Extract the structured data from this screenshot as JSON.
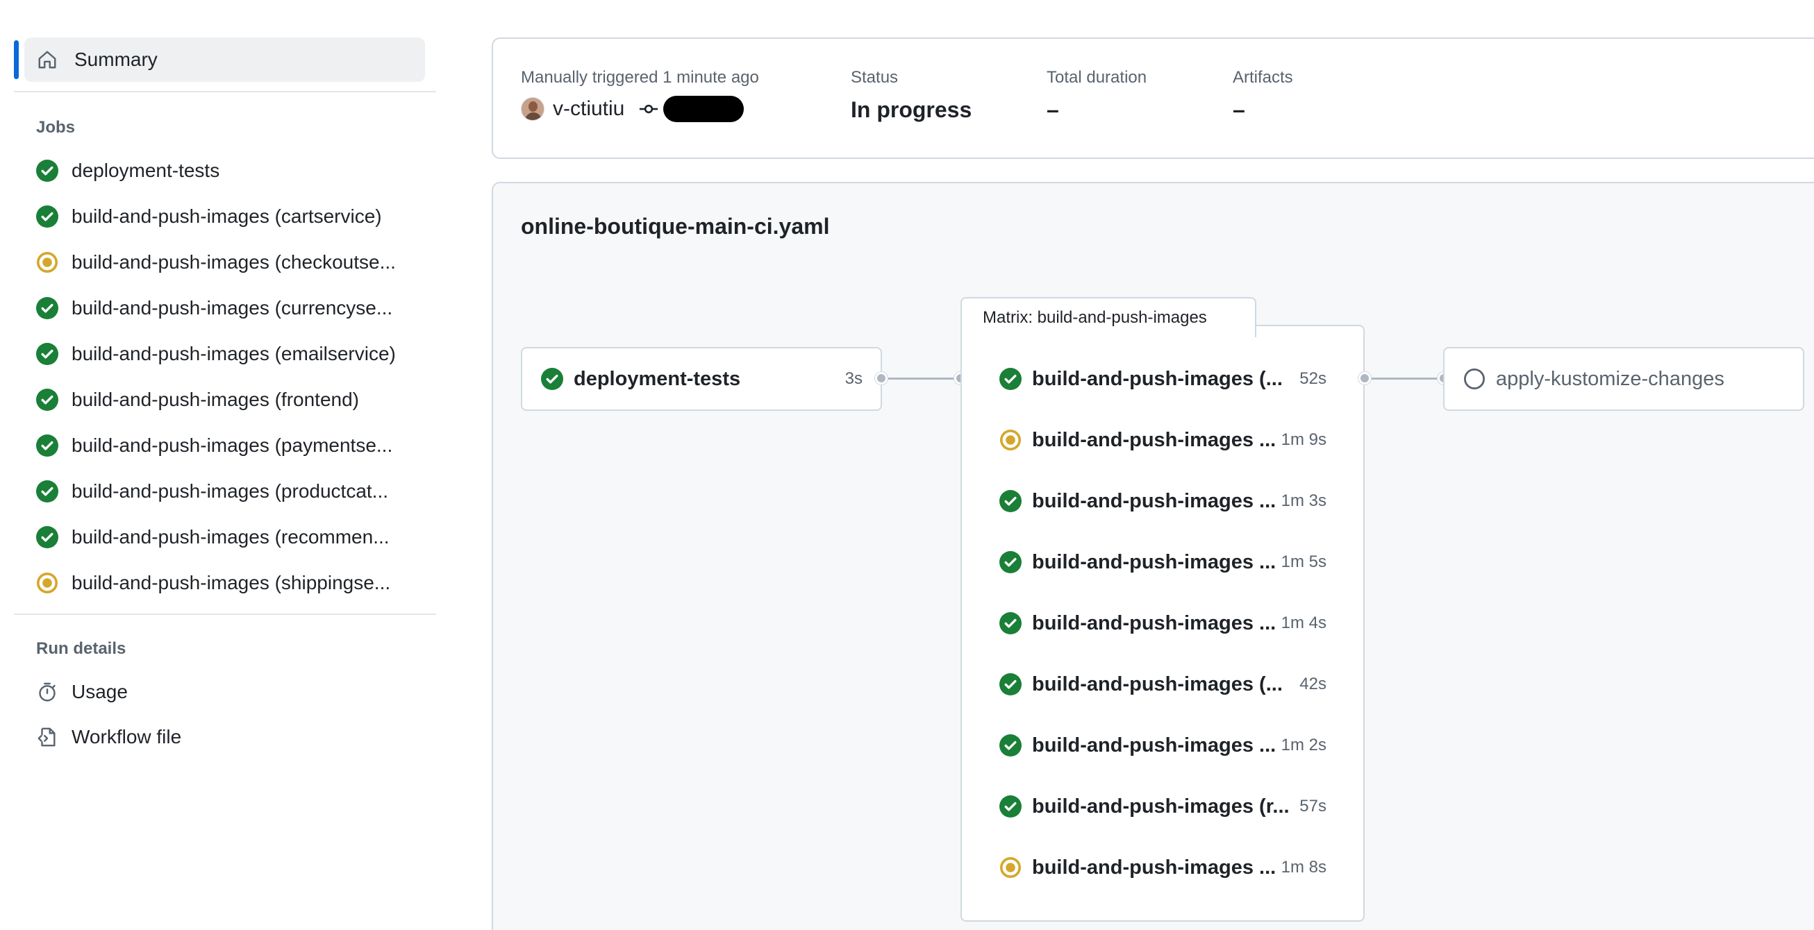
{
  "colors": {
    "success": "#1a7f37",
    "in_progress": "#d4a72c",
    "accent": "#0969da",
    "muted": "#59636e"
  },
  "sidebar": {
    "summary": {
      "label": "Summary",
      "icon": "home-icon"
    },
    "jobs_heading": "Jobs",
    "jobs": [
      {
        "label": "deployment-tests",
        "status": "success"
      },
      {
        "label": "build-and-push-images (cartservice)",
        "status": "success"
      },
      {
        "label": "build-and-push-images (checkoutse...",
        "status": "in_progress"
      },
      {
        "label": "build-and-push-images (currencyse...",
        "status": "success"
      },
      {
        "label": "build-and-push-images (emailservice)",
        "status": "success"
      },
      {
        "label": "build-and-push-images (frontend)",
        "status": "success"
      },
      {
        "label": "build-and-push-images (paymentse...",
        "status": "success"
      },
      {
        "label": "build-and-push-images (productcat...",
        "status": "success"
      },
      {
        "label": "build-and-push-images (recommen...",
        "status": "success"
      },
      {
        "label": "build-and-push-images (shippingse...",
        "status": "in_progress"
      }
    ],
    "run_details_heading": "Run details",
    "run_details": [
      {
        "label": "Usage",
        "icon": "stopwatch-icon"
      },
      {
        "label": "Workflow file",
        "icon": "file-code-icon"
      }
    ]
  },
  "run_info": {
    "trigger_caption": "Manually triggered 1 minute ago",
    "actor": "v-ctiutiu",
    "status_caption": "Status",
    "status_value": "In progress",
    "duration_caption": "Total duration",
    "duration_value": "–",
    "artifacts_caption": "Artifacts",
    "artifacts_value": "–"
  },
  "graph": {
    "title": "online-boutique-main-ci.yaml",
    "first_job": {
      "label": "deployment-tests",
      "duration": "3s",
      "status": "success"
    },
    "matrix": {
      "title": "Matrix: build-and-push-images",
      "rows": [
        {
          "label": "build-and-push-images (...",
          "duration": "52s",
          "status": "success"
        },
        {
          "label": "build-and-push-images ...",
          "duration": "1m 9s",
          "status": "in_progress"
        },
        {
          "label": "build-and-push-images ...",
          "duration": "1m 3s",
          "status": "success"
        },
        {
          "label": "build-and-push-images ...",
          "duration": "1m 5s",
          "status": "success"
        },
        {
          "label": "build-and-push-images ...",
          "duration": "1m 4s",
          "status": "success"
        },
        {
          "label": "build-and-push-images (...",
          "duration": "42s",
          "status": "success"
        },
        {
          "label": "build-and-push-images ...",
          "duration": "1m 2s",
          "status": "success"
        },
        {
          "label": "build-and-push-images (r...",
          "duration": "57s",
          "status": "success"
        },
        {
          "label": "build-and-push-images ...",
          "duration": "1m 8s",
          "status": "in_progress"
        }
      ]
    },
    "last_job": {
      "label": "apply-kustomize-changes",
      "status": "queued"
    }
  }
}
